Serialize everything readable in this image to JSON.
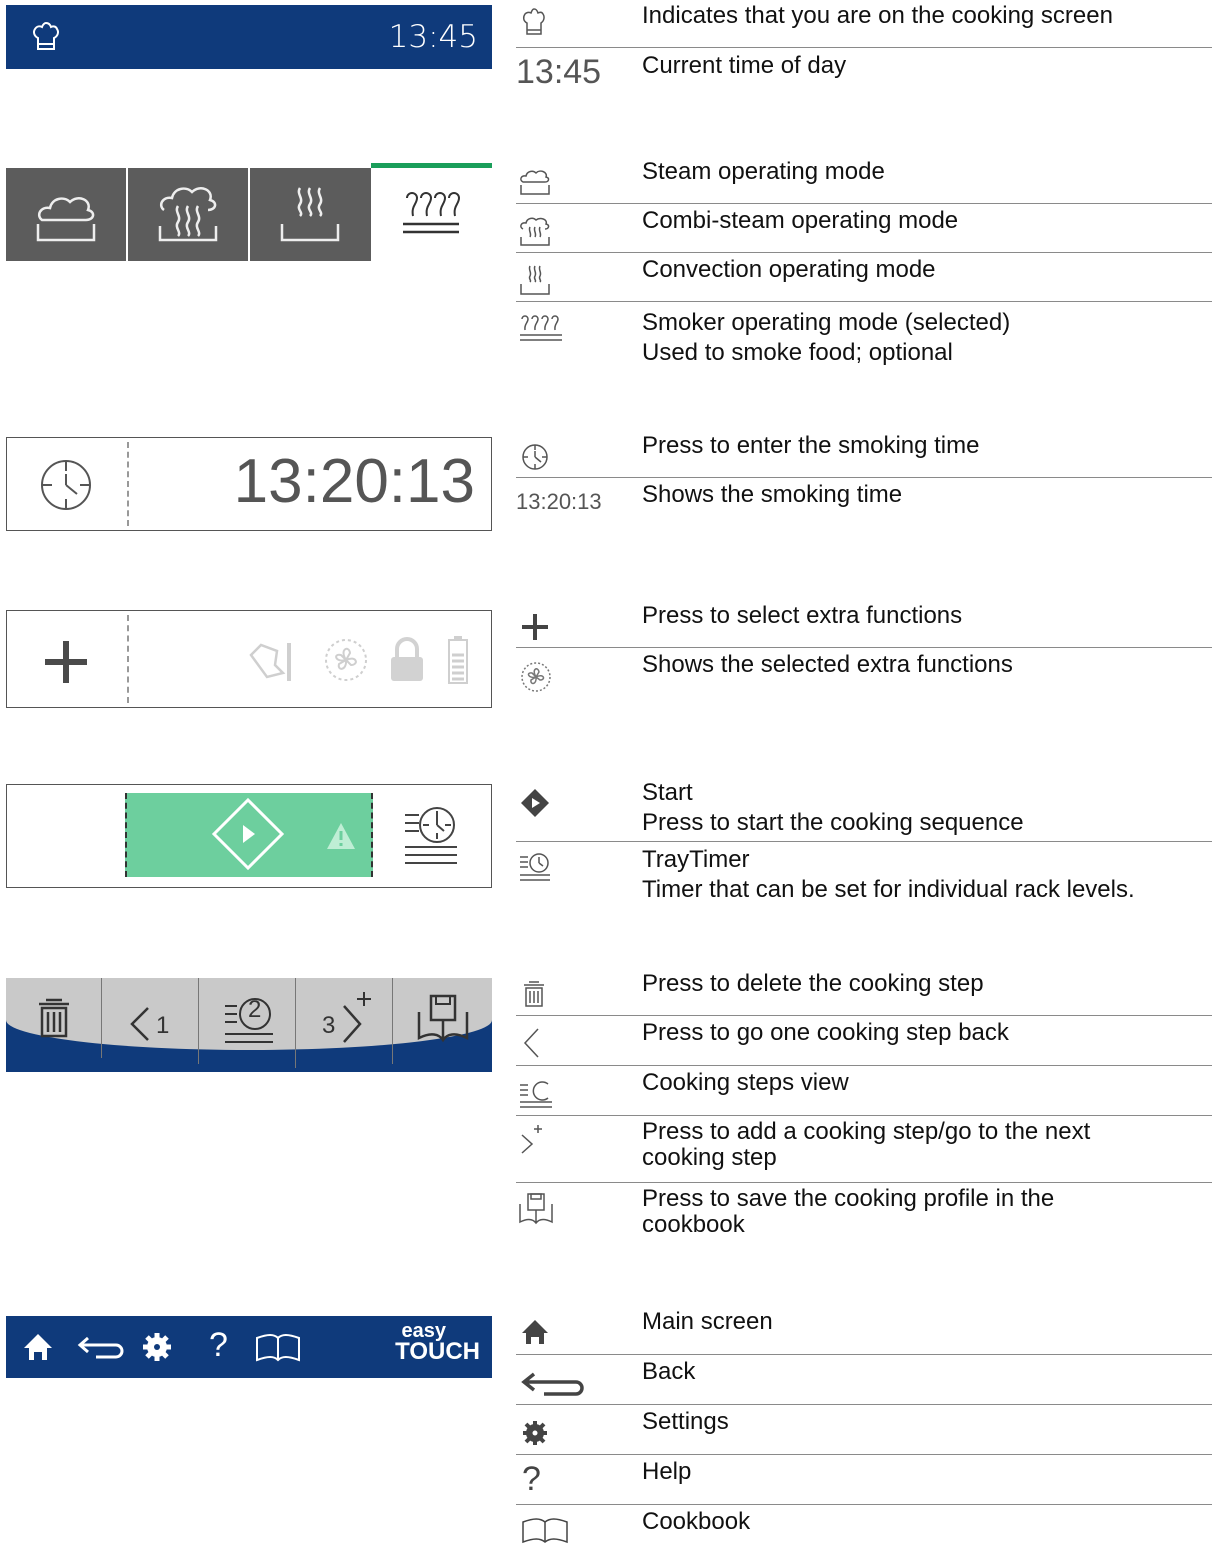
{
  "header_bar": {
    "time": "13:45",
    "bg": "#0f3a7b"
  },
  "clock_panel": {
    "time": "13:20:13"
  },
  "brand": {
    "line1": "easy",
    "line2": "TOUCH"
  },
  "legend": {
    "header": [
      {
        "icon": "chef-hat-icon",
        "text": "Indicates that you are on the cooking screen"
      },
      {
        "icon_text": "13:45",
        "text": "Current time of day"
      }
    ],
    "modes": [
      {
        "icon": "steam-mode-icon",
        "text": "Steam operating mode"
      },
      {
        "icon": "combi-steam-mode-icon",
        "text": "Combi-steam operating mode"
      },
      {
        "icon": "convection-mode-icon",
        "text": "Convection operating mode"
      },
      {
        "icon": "smoker-mode-icon",
        "text": "Smoker operating mode (selected)\nUsed to smoke food; optional"
      }
    ],
    "time": [
      {
        "icon": "clock-icon",
        "text": "Press to enter the smoking time"
      },
      {
        "icon_text": "13:20:13",
        "text": "Shows the smoking time"
      }
    ],
    "extras": [
      {
        "icon": "plus-icon",
        "text": "Press to select extra functions"
      },
      {
        "icon": "fan-icon",
        "text": "Shows the selected extra functions"
      }
    ],
    "start": [
      {
        "icon": "start-icon",
        "text": "Start\nPress to start the cooking sequence"
      },
      {
        "icon": "traytimer-icon",
        "text": "TrayTimer\nTimer that can be set for individual rack levels."
      }
    ],
    "steps": [
      {
        "icon": "trash-icon",
        "text": "Press to delete the cooking step"
      },
      {
        "icon": "chevron-left-icon",
        "text": "Press to go one cooking step back"
      },
      {
        "icon": "steps-view-icon",
        "text": "Cooking steps view"
      },
      {
        "icon": "add-step-icon",
        "text": "Press to add a cooking step/go to the next\ncooking step"
      },
      {
        "icon": "save-book-icon",
        "text": "Press to save the cooking profile in the\ncookbook"
      }
    ],
    "nav": [
      {
        "icon": "home-icon",
        "text": "Main screen"
      },
      {
        "icon": "back-arrow-icon",
        "text": "Back"
      },
      {
        "icon": "gear-icon",
        "text": "Settings"
      },
      {
        "icon": "help-icon",
        "text": "Help"
      },
      {
        "icon": "cookbook-icon",
        "text": "Cookbook"
      }
    ]
  },
  "step_bar": {
    "prev_num": "1",
    "current_num": "2",
    "next_num": "3"
  },
  "colors": {
    "navy": "#0f3a7b",
    "mode_gray": "#5c5c5c",
    "start_green": "#6dcf9e",
    "accent_green": "#1a9e5a",
    "light_gray": "#c9c9c9"
  }
}
